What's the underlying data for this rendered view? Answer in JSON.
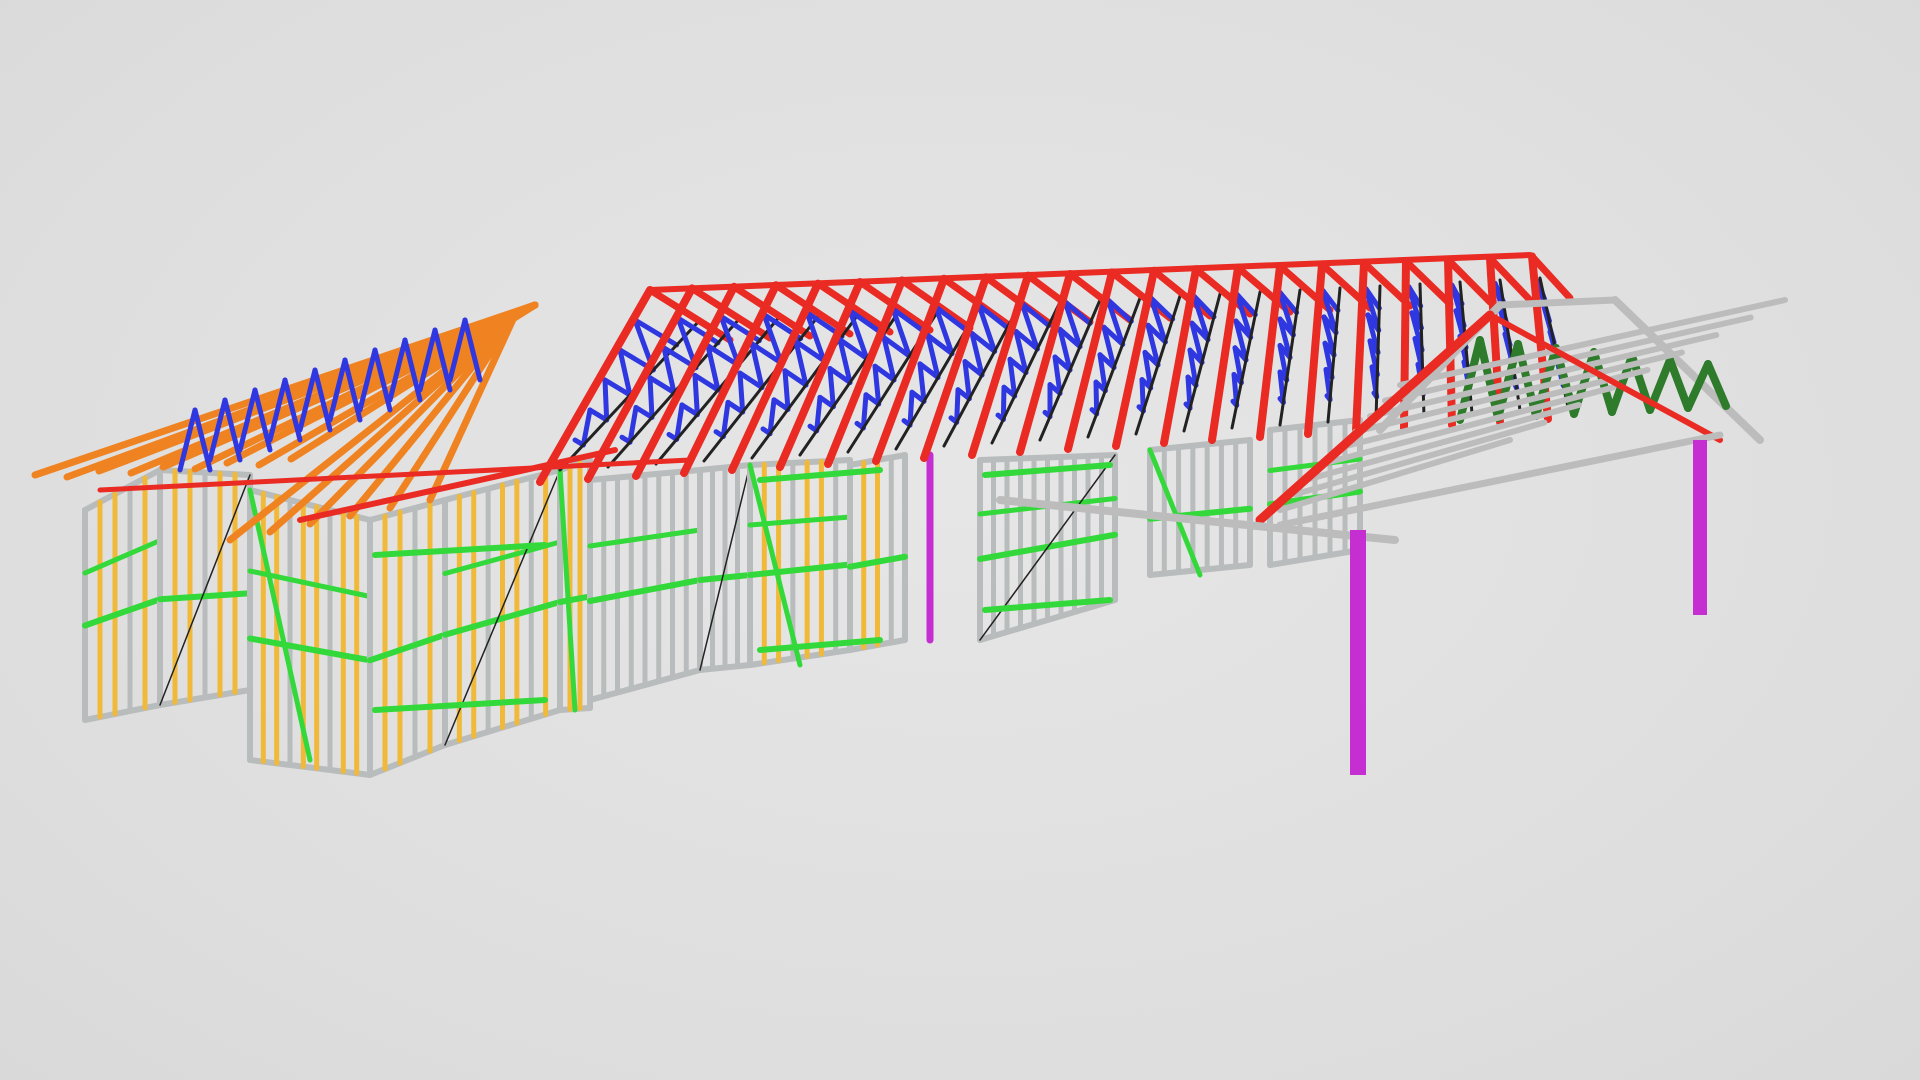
{
  "viewer": {
    "background": "#dedede",
    "model": {
      "subject": "steel-frame-house-with-trussed-roof-and-carport",
      "members": {
        "roof_truss_chords": "#ea2b23",
        "roof_truss_webs": "#2f37e0",
        "hip_jack_rafters": "#f08321",
        "wall_studs_timber": "#f0b93a",
        "wall_nogging_bracing": "#33d93a",
        "wall_frame_steel": "#b9bcbc",
        "carport_posts": "#c52fd2",
        "carport_truss_webs": "#2d7b2b",
        "carport_battens": "#bcbcbc",
        "dark_bracing": "#222222"
      }
    }
  }
}
